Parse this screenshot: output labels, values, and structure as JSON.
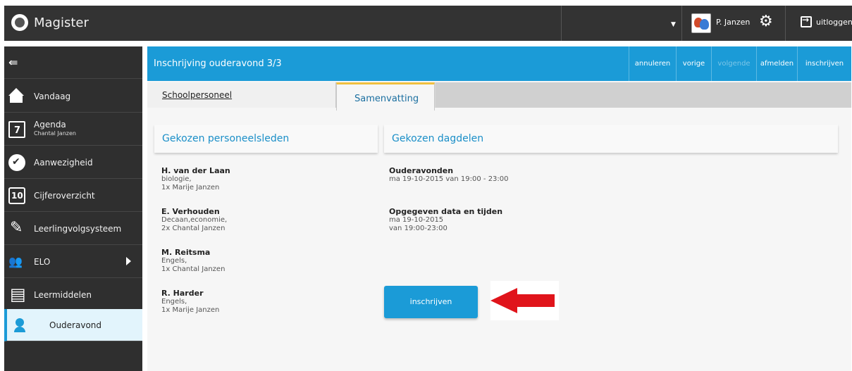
{
  "app": {
    "title": "Magister"
  },
  "user": {
    "name": "P. Janzen",
    "logout_label": "uitloggen"
  },
  "sidebar": {
    "items": [
      {
        "label": "Vandaag",
        "icon": "home-icon"
      },
      {
        "label": "Agenda",
        "sub": "Chantal Janzen",
        "icon": "calendar-icon"
      },
      {
        "label": "Aanwezigheid",
        "icon": "check-icon"
      },
      {
        "label": "Cijferoverzicht",
        "icon": "grades-icon"
      },
      {
        "label": "Leerlingvolgsysteem",
        "icon": "pencil-icon"
      },
      {
        "label": "ELO",
        "icon": "group-icon"
      },
      {
        "label": "Leermiddelen",
        "icon": "books-icon"
      },
      {
        "label": "Ouderavond",
        "icon": "parent-icon"
      }
    ]
  },
  "header": {
    "title": "Inschrijving ouderavond 3/3",
    "buttons": {
      "annuleren": "annuleren",
      "vorige": "vorige",
      "volgende": "volgende",
      "afmelden": "afmelden",
      "inschrijven": "inschrijven"
    }
  },
  "tabs": {
    "tab1": "Schoolpersoneel",
    "tab2": "Samenvatting"
  },
  "left": {
    "heading": "Gekozen personeelsleden",
    "staff": [
      {
        "name": "H. van der Laan",
        "subject": "biologie,",
        "child": "1x Marije Janzen"
      },
      {
        "name": "E. Verhouden",
        "subject": "Decaan,economie,",
        "child": "2x Chantal Janzen"
      },
      {
        "name": "M. Reitsma",
        "subject": "Engels,",
        "child": "1x Chantal Janzen"
      },
      {
        "name": "R. Harder",
        "subject": "Engels,",
        "child": "1x Marije Janzen"
      }
    ]
  },
  "right": {
    "heading": "Gekozen dagdelen",
    "evenings_title": "Ouderavonden",
    "evenings_value": "ma 19-10-2015 van 19:00 - 23:00",
    "given_title": "Opgegeven data en tijden",
    "given_date": "ma 19-10-2015",
    "given_time": "van 19:00-23:00",
    "submit_label": "inschrijven"
  },
  "colors": {
    "accent": "#1b9bd7",
    "arrow": "#e0141b",
    "tab_highlight": "#f0c040"
  }
}
